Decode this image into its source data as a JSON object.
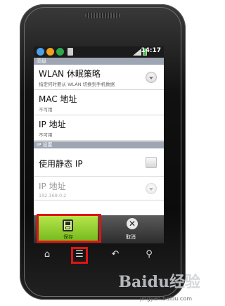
{
  "statusbar": {
    "time": "14:17"
  },
  "sections": {
    "advanced": "高级",
    "ip_settings": "IP 设置"
  },
  "items": [
    {
      "title": "WLAN 休眠策略",
      "subtitle": "指定何时要从 WLAN 切换到手机数据"
    },
    {
      "title": "MAC 地址",
      "subtitle": "不可用"
    },
    {
      "title": "IP 地址",
      "subtitle": "不可用"
    },
    {
      "title": "使用静态 IP",
      "subtitle": ""
    },
    {
      "title": "IP 地址",
      "subtitle": "192.168.0.2"
    }
  ],
  "buttons": {
    "save": "保存",
    "cancel": "取消"
  },
  "colors": {
    "highlight": "#e01414",
    "save_bg": "#9ad336",
    "section_bg": "#9ea6b3"
  },
  "watermark": {
    "brand": "Baidu经验",
    "url": "jingyan.baidu.com"
  },
  "navkeys": [
    "home-icon",
    "menu-icon",
    "back-icon",
    "search-icon"
  ]
}
